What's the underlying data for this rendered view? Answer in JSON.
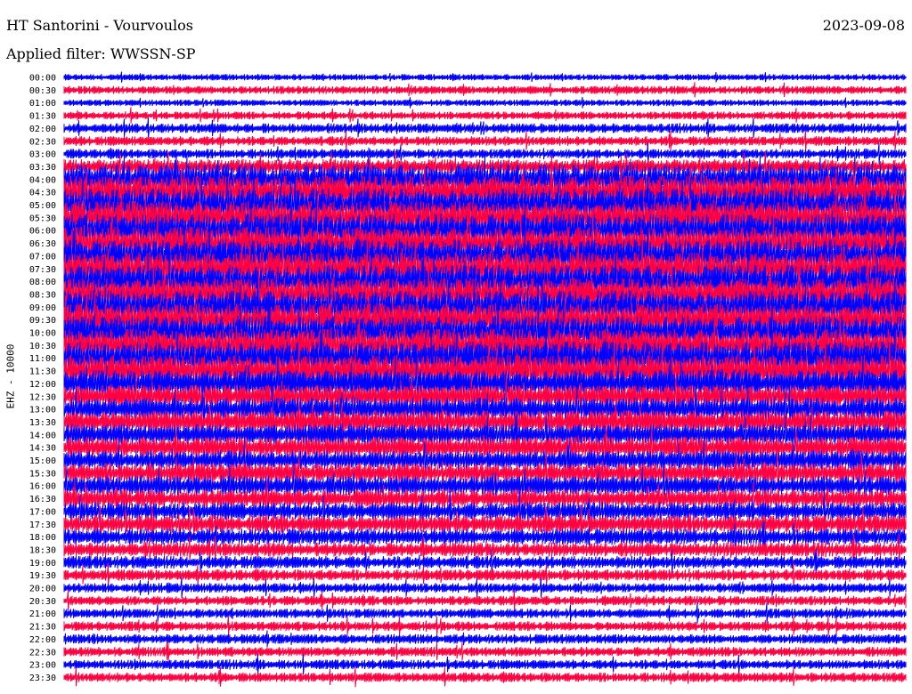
{
  "header": {
    "station_title": "HT Santorini - Vourvoulos",
    "filter_label": "Applied filter: WWSSN-SP",
    "date": "2023-09-08"
  },
  "chart_data": {
    "type": "line",
    "title": "HT Santorini - Vourvoulos",
    "subtitle": "Applied filter: WWSSN-SP",
    "ylabel": "EHZ - 10000",
    "xlabel": "",
    "rows": [
      "00:00",
      "00:30",
      "01:00",
      "01:30",
      "02:00",
      "02:30",
      "03:00",
      "03:30",
      "04:00",
      "04:30",
      "05:00",
      "05:30",
      "06:00",
      "06:30",
      "07:00",
      "07:30",
      "08:00",
      "08:30",
      "09:00",
      "09:30",
      "10:00",
      "10:30",
      "11:00",
      "11:30",
      "12:00",
      "12:30",
      "13:00",
      "13:30",
      "14:00",
      "14:30",
      "15:00",
      "15:30",
      "16:00",
      "16:30",
      "17:00",
      "17:30",
      "18:00",
      "18:30",
      "19:00",
      "19:30",
      "20:00",
      "20:30",
      "21:00",
      "21:30",
      "22:00",
      "22:30",
      "23:00",
      "23:30"
    ],
    "row_duration_minutes": 30,
    "trace_colors": [
      "#0000ff",
      "#ff0040"
    ],
    "color_alternation": "blue/red alternating per row",
    "relative_noise_level": [
      0.2,
      0.25,
      0.2,
      0.25,
      0.3,
      0.3,
      0.3,
      0.45,
      0.9,
      1,
      1,
      1,
      1,
      1,
      1,
      1,
      1,
      1,
      1,
      1,
      1,
      1,
      1,
      0.95,
      0.85,
      0.7,
      0.7,
      0.7,
      0.65,
      0.65,
      0.6,
      0.6,
      0.6,
      0.55,
      0.55,
      0.55,
      0.5,
      0.45,
      0.4,
      0.35,
      0.3,
      0.3,
      0.3,
      0.3,
      0.3,
      0.3,
      0.3,
      0.3
    ],
    "grid": false
  }
}
